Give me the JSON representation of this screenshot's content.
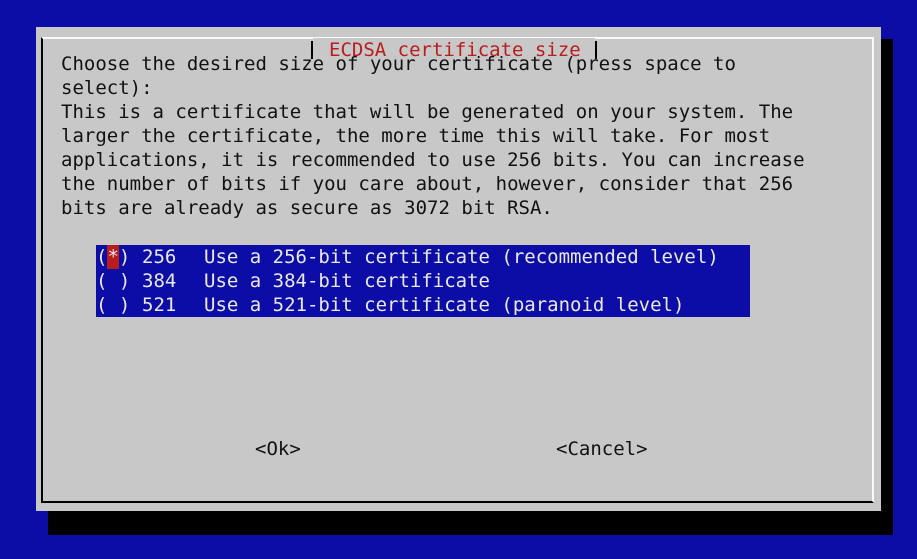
{
  "dialog": {
    "title": "ECDSA certificate size",
    "body": "Choose the desired size of your certificate (press space to\nselect):\nThis is a certificate that will be generated on your system. The\nlarger the certificate, the more time this will take. For most\napplications, it is recommended to use 256 bits. You can increase\nthe number of bits if you care about, however, consider that 256\nbits are already as secure as 3072 bit RSA."
  },
  "options": [
    {
      "marker": "*",
      "value": "256",
      "description": "Use a 256-bit certificate (recommended level)",
      "selected": true
    },
    {
      "marker": " ",
      "value": "384",
      "description": "Use a 384-bit certificate",
      "selected": false
    },
    {
      "marker": " ",
      "value": "521",
      "description": "Use a 521-bit certificate (paranoid level)",
      "selected": false
    }
  ],
  "buttons": {
    "ok": "<Ok>",
    "cancel": "<Cancel>"
  },
  "colors": {
    "background": "#0c0ca6",
    "dialog": "#c8c8c8",
    "title": "#b81c1c",
    "cursor": "#b81c1c",
    "menu_text": "#e9e9e9"
  }
}
